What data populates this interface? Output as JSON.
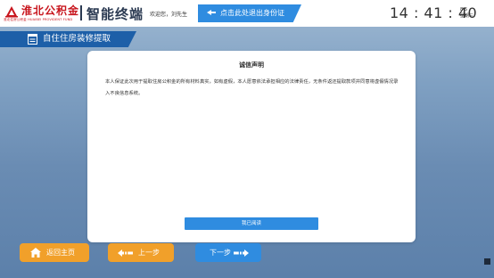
{
  "header": {
    "logo_cn": "淮北公积金",
    "logo_sub": "淮北住房公积金 HUAIBEI PROVIDENT FUND",
    "system_title": "智能终端",
    "welcome": "欢迎您，刘先生",
    "exit_button": "点击此处退出身份证",
    "time": "14 : 41 : 40",
    "date": "8-5",
    "weekday": "星期三"
  },
  "page": {
    "title": "自住住房装修提取"
  },
  "dialog": {
    "title": "诚信声明",
    "body": "本人保证此次用于提取住房公积金的所有材料真实，如有虚假，本人愿意依法承担相应的法律责任，无条件返还提取款项并同意将虚假情况录入不良信息系统。",
    "agree_button": "我已阅读"
  },
  "nav": {
    "home": "返回主页",
    "prev": "上一步",
    "next": "下一步"
  },
  "colors": {
    "brand_red": "#c8151d",
    "primary_blue": "#2f8ce0",
    "tab_blue": "#1d5fa8",
    "orange": "#f1a02a"
  },
  "icons": {
    "logo": "provident-fund-logo-icon",
    "exit": "hand-pointer-icon",
    "page": "document-icon",
    "home": "home-icon",
    "prev": "arrow-left-icon",
    "next": "arrow-right-icon"
  }
}
